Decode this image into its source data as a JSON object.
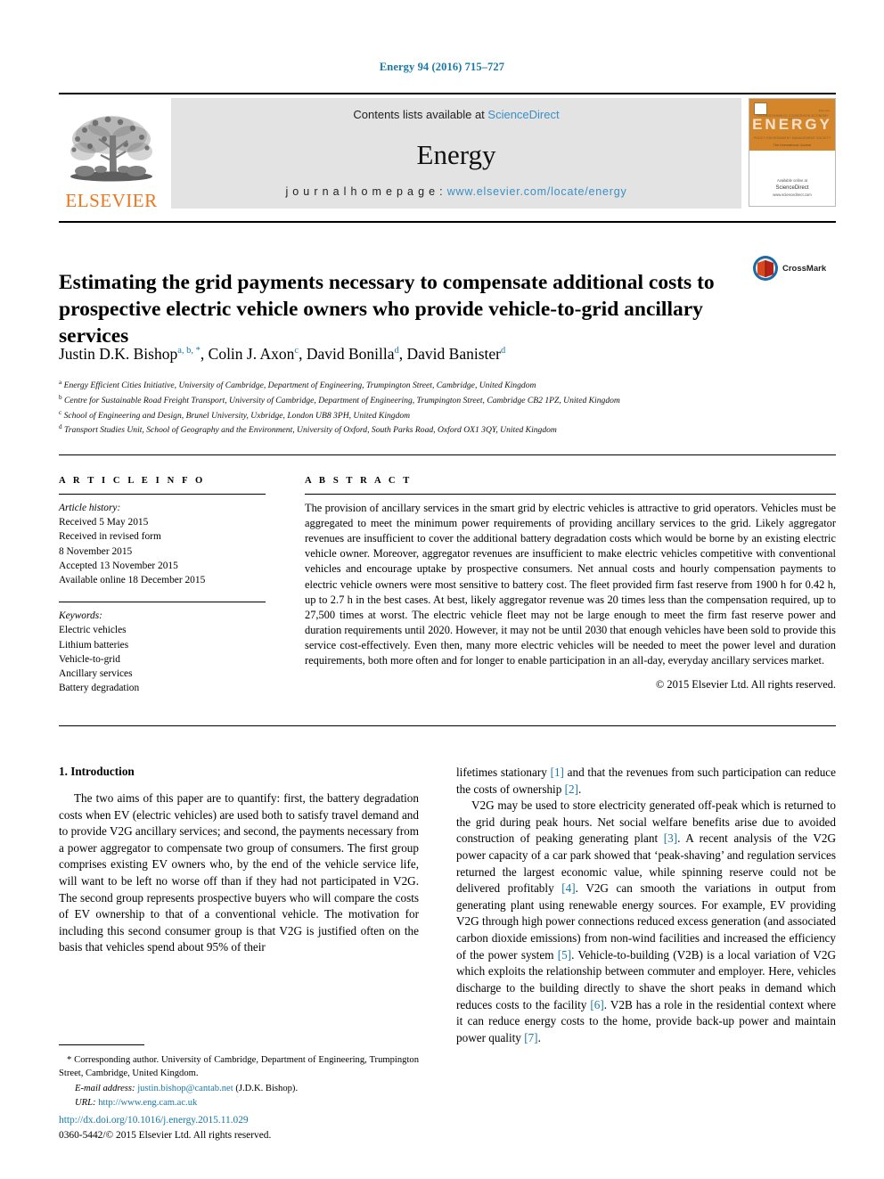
{
  "running_head": "Energy 94 (2016) 715–727",
  "masthead": {
    "publisher": "ELSEVIER",
    "contents_prefix": "Contents lists available at ",
    "contents_link": "ScienceDirect",
    "journal_name": "Energy",
    "homepage_prefix": "j o u r n a l   h o m e p a g e :  ",
    "homepage_link": "www.elsevier.com/locate/energy",
    "cover": {
      "title_word": "ENERGY",
      "mini_line_1": "Elsevier",
      "mini_top_row": "THERMODYNAMICS    CONVERSION    ECONOMY    SYSTEMS",
      "mini_bottom_row": "POLICY     ENVIRONMENT     MANAGEMENT     SOCIETY",
      "mini_tagline": "The International Journal",
      "footer_small": "Available online at",
      "footer_big": "ScienceDirect",
      "footer_sub": "www.sciencedirect.com"
    }
  },
  "crossmark": {
    "label": "CrossMark"
  },
  "title": "Estimating the grid payments necessary to compensate additional costs to prospective electric vehicle owners who provide vehicle-to-grid ancillary services",
  "authors": [
    {
      "name": "Justin D.K. Bishop",
      "marks": "a, b, *"
    },
    {
      "name": "Colin J. Axon",
      "marks": "c"
    },
    {
      "name": "David Bonilla",
      "marks": "d"
    },
    {
      "name": "David Banister",
      "marks": "d"
    }
  ],
  "affiliations": [
    {
      "mark": "a",
      "text": "Energy Efficient Cities Initiative, University of Cambridge, Department of Engineering, Trumpington Street, Cambridge, United Kingdom"
    },
    {
      "mark": "b",
      "text": "Centre for Sustainable Road Freight Transport, University of Cambridge, Department of Engineering, Trumpington Street, Cambridge CB2 1PZ, United Kingdom"
    },
    {
      "mark": "c",
      "text": "School of Engineering and Design, Brunel University, Uxbridge, London UB8 3PH, United Kingdom"
    },
    {
      "mark": "d",
      "text": "Transport Studies Unit, School of Geography and the Environment, University of Oxford, South Parks Road, Oxford OX1 3QY, United Kingdom"
    }
  ],
  "article_info": {
    "heading": "A R T I C L E   I N F O",
    "history_label": "Article history:",
    "history": [
      "Received 5 May 2015",
      "Received in revised form",
      "8 November 2015",
      "Accepted 13 November 2015",
      "Available online 18 December 2015"
    ],
    "keywords_label": "Keywords:",
    "keywords": [
      "Electric vehicles",
      "Lithium batteries",
      "Vehicle-to-grid",
      "Ancillary services",
      "Battery degradation"
    ]
  },
  "abstract": {
    "heading": "A B S T R A C T",
    "text": "The provision of ancillary services in the smart grid by electric vehicles is attractive to grid operators. Vehicles must be aggregated to meet the minimum power requirements of providing ancillary services to the grid. Likely aggregator revenues are insufficient to cover the additional battery degradation costs which would be borne by an existing electric vehicle owner. Moreover, aggregator revenues are insufficient to make electric vehicles competitive with conventional vehicles and encourage uptake by prospective consumers. Net annual costs and hourly compensation payments to electric vehicle owners were most sensitive to battery cost. The fleet provided firm fast reserve from 1900 h for 0.42 h, up to 2.7 h in the best cases. At best, likely aggregator revenue was 20 times less than the compensation required, up to 27,500 times at worst. The electric vehicle fleet may not be large enough to meet the firm fast reserve power and duration requirements until 2020. However, it may not be until 2030 that enough vehicles have been sold to provide this service cost-effectively. Even then, many more electric vehicles will be needed to meet the power level and duration requirements, both more often and for longer to enable participation in an all-day, everyday ancillary services market.",
    "copyright": "© 2015 Elsevier Ltd. All rights reserved."
  },
  "body": {
    "section_title": "1.  Introduction",
    "left_paragraphs": [
      "The two aims of this paper are to quantify: first, the battery degradation costs when EV (electric vehicles) are used both to satisfy travel demand and to provide V2G ancillary services; and second, the payments necessary from a power aggregator to compensate two group of consumers. The first group comprises existing EV owners who, by the end of the vehicle service life, will want to be left no worse off than if they had not participated in V2G. The second group represents prospective buyers who will compare the costs of EV ownership to that of a conventional vehicle. The motivation for including this second consumer group is that V2G is justified often on the basis that vehicles spend about 95% of their"
    ],
    "right_paragraphs": [
      {
        "indent": false,
        "runs": [
          {
            "t": "lifetimes stationary "
          },
          {
            "t": "[1]",
            "ref": true
          },
          {
            "t": " and that the revenues from such participation can reduce the costs of ownership "
          },
          {
            "t": "[2]",
            "ref": true
          },
          {
            "t": "."
          }
        ]
      },
      {
        "indent": true,
        "runs": [
          {
            "t": "V2G may be used to store electricity generated off-peak which is returned to the grid during peak hours. Net social welfare benefits arise due to avoided construction of peaking generating plant "
          },
          {
            "t": "[3]",
            "ref": true
          },
          {
            "t": ". A recent analysis of the V2G power capacity of a car park showed that ‘peak-shaving’ and regulation services returned the largest economic value, while spinning reserve could not be delivered profitably "
          },
          {
            "t": "[4]",
            "ref": true
          },
          {
            "t": ". V2G can smooth the variations in output from generating plant using renewable energy sources. For example, EV providing V2G through high power connections reduced excess generation (and associated carbon dioxide emissions) from non-wind facilities and increased the efficiency of the power system "
          },
          {
            "t": "[5]",
            "ref": true
          },
          {
            "t": ". Vehicle-to-building (V2B) is a local variation of V2G which exploits the relationship between commuter and employer. Here, vehicles discharge to the building directly to shave the short peaks in demand which reduces costs to the facility "
          },
          {
            "t": "[6]",
            "ref": true
          },
          {
            "t": ". V2B has a role in the residential context where it can reduce energy costs to the home, provide back-up power and maintain power quality "
          },
          {
            "t": "[7]",
            "ref": true
          },
          {
            "t": "."
          }
        ]
      }
    ]
  },
  "footnotes": {
    "corresponding": "* Corresponding author. University of Cambridge, Department of Engineering, Trumpington Street, Cambridge, United Kingdom.",
    "email_label": "E-mail address:",
    "email_value": "justin.bishop@cantab.net",
    "email_suffix": "(J.D.K. Bishop).",
    "url_label": "URL:",
    "url_value": "http://www.eng.cam.ac.uk"
  },
  "footer": {
    "doi": "http://dx.doi.org/10.1016/j.energy.2015.11.029",
    "issn_line": "0360-5442/© 2015 Elsevier Ltd. All rights reserved."
  },
  "colors": {
    "link_blue": "#1878a8",
    "sciencedirect_blue": "#3a8fc4",
    "elsevier_orange": "#E87722",
    "banner_gray": "#e3e3e3"
  }
}
